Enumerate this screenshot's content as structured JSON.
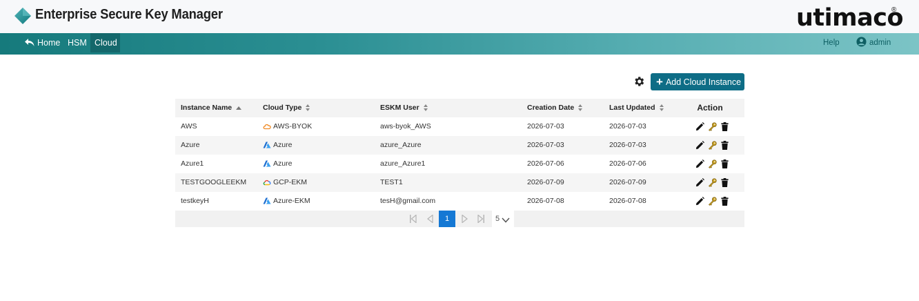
{
  "header": {
    "title": "Enterprise Secure Key Manager",
    "brand": "utimaco",
    "brand_mark": "®"
  },
  "nav": {
    "home": "Home",
    "hsm": "HSM",
    "cloud": "Cloud",
    "help": "Help",
    "user": "admin",
    "active": "Cloud"
  },
  "toolbar": {
    "add_label": "Add Cloud Instance"
  },
  "table": {
    "columns": {
      "name": "Instance Name",
      "type": "Cloud Type",
      "user": "ESKM User",
      "created": "Creation Date",
      "updated": "Last Updated",
      "action": "Action"
    },
    "rows": [
      {
        "name": "AWS",
        "type": "AWS-BYOK",
        "type_icon": "aws-cloud-icon",
        "user": "aws-byok_AWS",
        "created": "2026-07-03",
        "updated": "2026-07-03"
      },
      {
        "name": "Azure",
        "type": "Azure",
        "type_icon": "azure-icon",
        "user": "azure_Azure",
        "created": "2026-07-03",
        "updated": "2026-07-03"
      },
      {
        "name": "Azure1",
        "type": "Azure",
        "type_icon": "azure-icon",
        "user": "azure_Azure1",
        "created": "2026-07-06",
        "updated": "2026-07-06"
      },
      {
        "name": "TESTGOOGLEEKM",
        "type": "GCP-EKM",
        "type_icon": "gcp-icon",
        "user": "TEST1",
        "created": "2026-07-09",
        "updated": "2026-07-09"
      },
      {
        "name": "testkeyH",
        "type": "Azure-EKM",
        "type_icon": "azure-icon",
        "user": "tesH@gmail.com",
        "created": "2026-07-08",
        "updated": "2026-07-08"
      }
    ]
  },
  "pager": {
    "current_page": "1",
    "page_size": "5"
  },
  "colors": {
    "accent": "#0e6d86",
    "nav_start": "#167a7c",
    "nav_end": "#7cc4c6",
    "pager_active": "#1478d4",
    "aws_orange": "#f08a24",
    "azure_blue": "#1f6fd1"
  }
}
